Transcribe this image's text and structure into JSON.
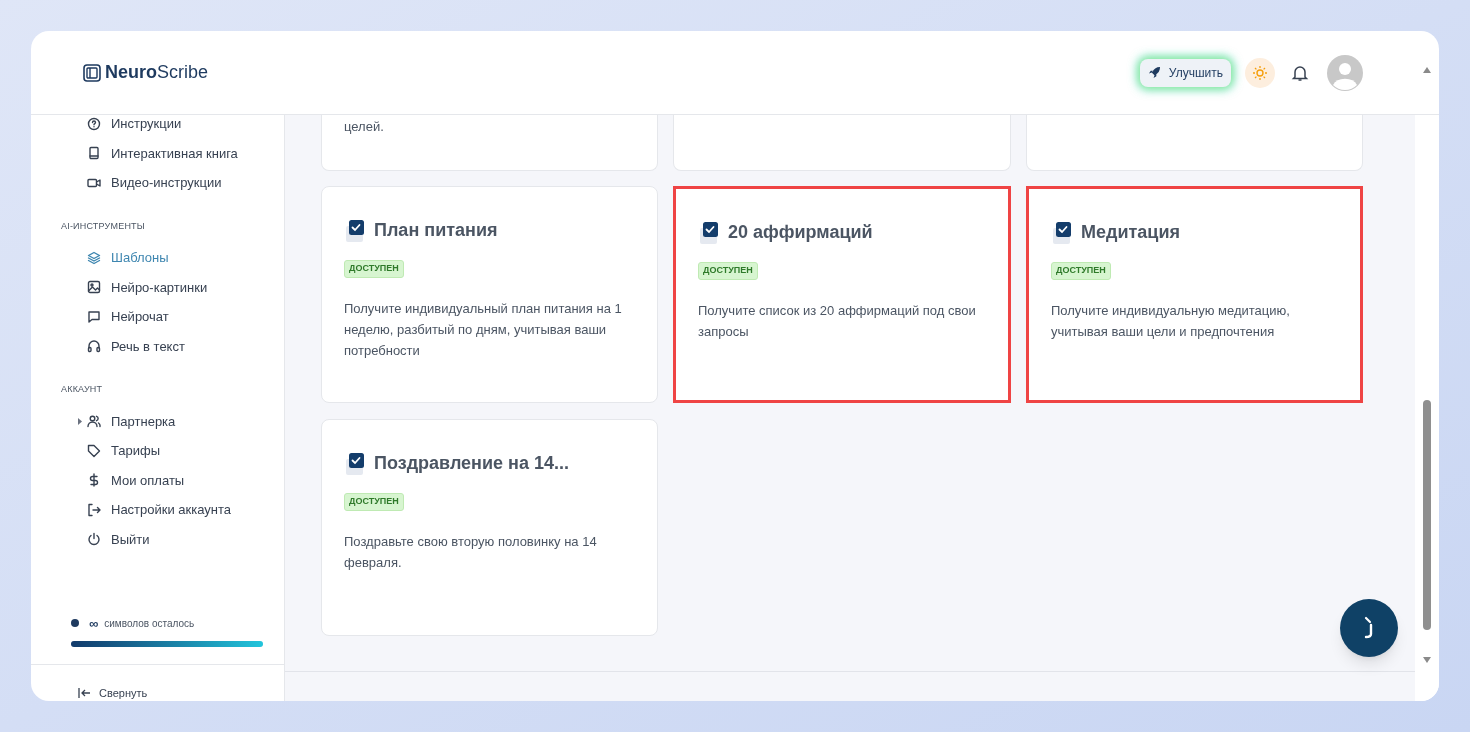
{
  "brand": {
    "bold": "Neuro",
    "light": "Scribe"
  },
  "header": {
    "upgrade_button": "Улучшить"
  },
  "sidebar": {
    "sections": [
      {
        "items": [
          {
            "label": "Инструкции",
            "selected": false,
            "expandable": false
          },
          {
            "label": "Интерактивная книга",
            "selected": false,
            "expandable": false
          },
          {
            "label": "Видео-инструкции",
            "selected": false,
            "expandable": false
          }
        ]
      },
      {
        "title": "AI-ИНСТРУМЕНТЫ",
        "items": [
          {
            "label": "Шаблоны",
            "selected": true,
            "expandable": false
          },
          {
            "label": "Нейро-картинки",
            "selected": false,
            "expandable": false
          },
          {
            "label": "Нейрочат",
            "selected": false,
            "expandable": false
          },
          {
            "label": "Речь в текст",
            "selected": false,
            "expandable": false
          }
        ]
      },
      {
        "title": "АККАУНТ",
        "items": [
          {
            "label": "Партнерка",
            "selected": false,
            "expandable": true
          },
          {
            "label": "Тарифы",
            "selected": false,
            "expandable": false
          },
          {
            "label": "Мои оплаты",
            "selected": false,
            "expandable": false
          },
          {
            "label": "Настройки аккаунта",
            "selected": false,
            "expandable": false
          },
          {
            "label": "Выйти",
            "selected": false,
            "expandable": false
          }
        ]
      }
    ],
    "quota": {
      "symbol": "∞",
      "label": "символов осталось",
      "level": 1
    },
    "collapse": "Свернуть"
  },
  "top_card_text": "целей.",
  "cards": [
    {
      "title": "План питания",
      "badge": "ДОСТУПЕН",
      "description": "Получите индивидуальный план питания на 1 неделю, разбитый по дням, учитывая ваши потребности",
      "highlighted": false
    },
    {
      "title": "20 аффирмаций",
      "badge": "ДОСТУПЕН",
      "description": "Получите список из 20 аффирмаций под свои запросы",
      "highlighted": true
    },
    {
      "title": "Медитация",
      "badge": "ДОСТУПЕН",
      "description": "Получите индивидуальную медитацию, учитывая ваши цели и предпочтения",
      "highlighted": true
    },
    {
      "title": "Поздравление на 14...",
      "badge": "ДОСТУПЕН",
      "description": "Поздравьте свою вторую половинку на 14 февраля.",
      "highlighted": false
    }
  ]
}
